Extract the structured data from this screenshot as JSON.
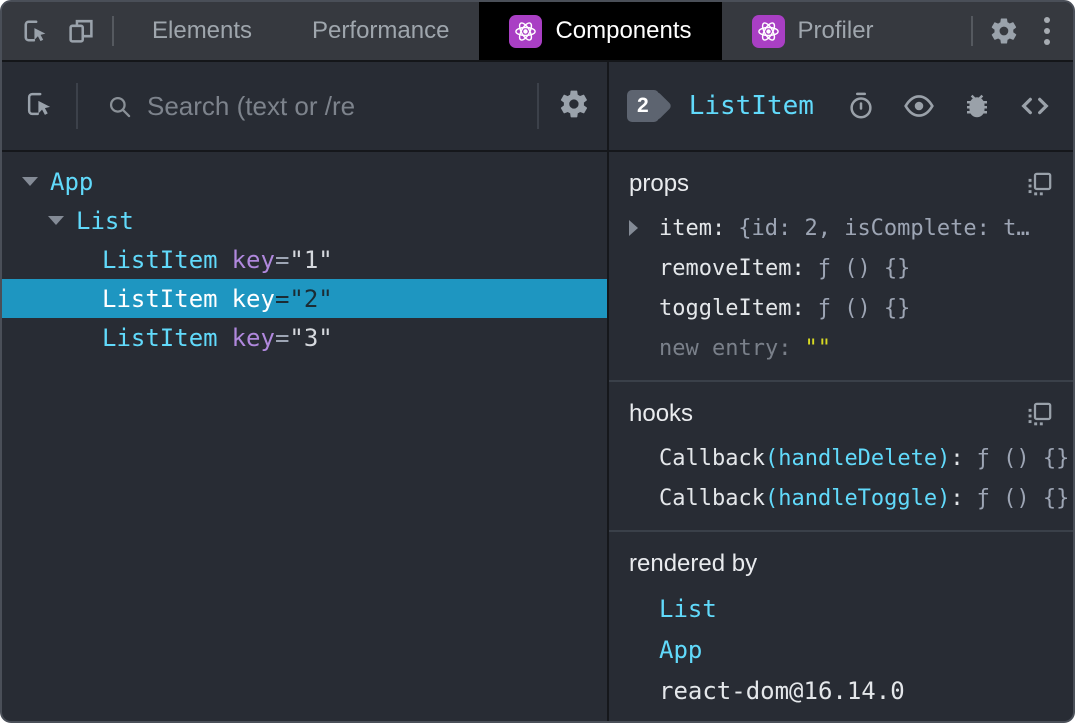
{
  "topbar": {
    "tabs": [
      {
        "label": "Elements",
        "active": false,
        "react_icon": false
      },
      {
        "label": "Performance",
        "active": false,
        "react_icon": false
      },
      {
        "label": "Components",
        "active": true,
        "react_icon": true
      },
      {
        "label": "Profiler",
        "active": false,
        "react_icon": true
      }
    ]
  },
  "left_panel": {
    "search": {
      "placeholder": "Search (text or /re"
    },
    "tree": [
      {
        "name": "App",
        "depth": 0,
        "expanded": true,
        "selected": false
      },
      {
        "name": "List",
        "depth": 1,
        "expanded": true,
        "selected": false
      },
      {
        "name": "ListItem",
        "attr": "key",
        "value": "\"1\"",
        "depth": 2,
        "selected": false
      },
      {
        "name": "ListItem",
        "attr": "key",
        "value": "\"2\"",
        "depth": 2,
        "selected": true
      },
      {
        "name": "ListItem",
        "attr": "key",
        "value": "\"3\"",
        "depth": 2,
        "selected": false
      }
    ]
  },
  "right_panel": {
    "selected_index_badge": "2",
    "component_name": "ListItem",
    "props": {
      "title": "props",
      "rows": [
        {
          "name": "item",
          "value": "{id: 2, isComplete: t…",
          "expandable": true,
          "is_new_entry": false
        },
        {
          "name": "removeItem",
          "value": "ƒ () {}",
          "expandable": false,
          "is_new_entry": false
        },
        {
          "name": "toggleItem",
          "value": "ƒ () {}",
          "expandable": false,
          "is_new_entry": false
        },
        {
          "name": "new entry",
          "value": "\"\"",
          "expandable": false,
          "is_new_entry": true
        }
      ]
    },
    "hooks": {
      "title": "hooks",
      "rows": [
        {
          "kind": "Callback",
          "hook_name": "(handleDelete)",
          "value": "ƒ () {}"
        },
        {
          "kind": "Callback",
          "hook_name": "(handleToggle)",
          "value": "ƒ () {}"
        }
      ]
    },
    "rendered_by": {
      "title": "rendered by",
      "items": [
        {
          "label": "List",
          "link": true
        },
        {
          "label": "App",
          "link": true
        },
        {
          "label": "react-dom@16.14.0",
          "link": false
        }
      ]
    }
  },
  "colors": {
    "accent_cyan": "#61dafb",
    "selection_blue": "#1e96c1",
    "react_purple": "#a93fc4",
    "attr_purple": "#b088dd",
    "value_gray": "#9da5b4",
    "new_entry_yellow": "#d8da23",
    "active_tab_bg": "#000000",
    "panel_bg": "#282c34",
    "topbar_bg": "#36393f"
  }
}
